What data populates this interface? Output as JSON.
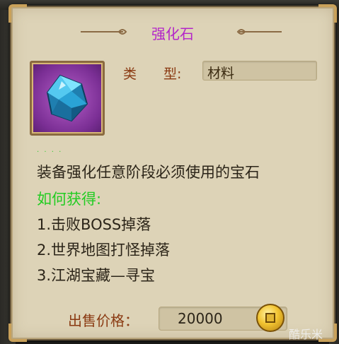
{
  "item": {
    "name": "强化石",
    "type_label": "类　　型:",
    "type_value": "材料",
    "description": "装备强化任意阶段必须使用的宝石",
    "how_to_get_title": "如何获得:",
    "methods": [
      "1.击败BOSS掉落",
      "2.世界地图打怪掉落",
      "3.江湖宝藏—寻宝"
    ],
    "sell_label": "出售价格：",
    "sell_price": "20000",
    "icon": "blue-gem-icon"
  },
  "watermark": "酷乐米",
  "colors": {
    "title": "#b324c9",
    "label": "#8a3a12",
    "how_to_get": "#22cc22",
    "panel_bg": "#ddd3b7"
  }
}
